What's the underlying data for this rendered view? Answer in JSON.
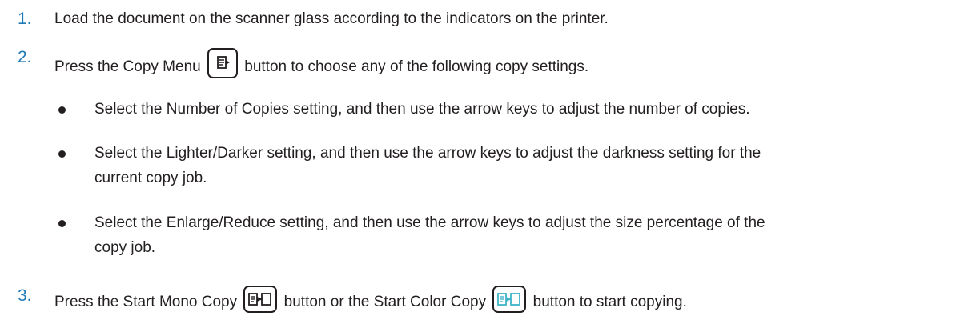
{
  "steps": [
    {
      "number": "1.",
      "text": "Load the document on the scanner glass according to the indicators on the printer."
    },
    {
      "number": "2.",
      "text_before": "Press the Copy Menu",
      "text_after": "button to choose any of the following copy settings.",
      "icon": "copy-menu-icon"
    },
    {
      "number": "3.",
      "text_before": "Press the Start Mono Copy",
      "text_middle": "button or the Start Color Copy",
      "text_after": "button to start copying.",
      "icons": [
        "start-mono-copy-icon",
        "start-color-copy-icon"
      ]
    }
  ],
  "bullets": [
    {
      "line1": "Select the Number of Copies setting, and then use the arrow keys to adjust the number of copies."
    },
    {
      "line1": "Select the Lighter/Darker setting, and then use the arrow keys to adjust the darkness setting for the",
      "line2": "current copy job."
    },
    {
      "line1": "Select the Enlarge/Reduce setting, and then use the arrow keys to adjust the size percentage of the",
      "line2": "copy job."
    }
  ],
  "colors": {
    "step_number": "#1f7ab8",
    "text": "#231f20",
    "color_copy_icon": "#3fb4c9"
  }
}
